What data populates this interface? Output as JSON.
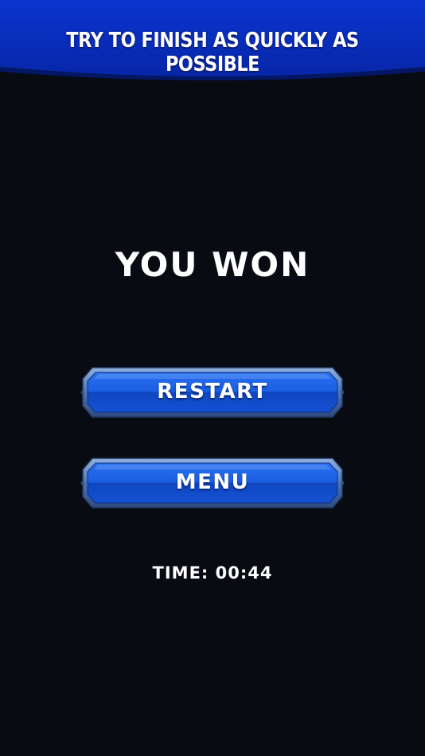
{
  "banner": {
    "text": "TRY TO FINISH AS QUICKLY AS POSSIBLE"
  },
  "result": {
    "title": "YOU WON"
  },
  "buttons": {
    "restart_label": "RESTART",
    "menu_label": "MENU"
  },
  "timer": {
    "text": "TIME: 00:44"
  },
  "colors": {
    "background": "#080b12",
    "banner_blue": "#0a33c8",
    "button_blue": "#1556d8",
    "button_frame": "#5f86c0"
  }
}
